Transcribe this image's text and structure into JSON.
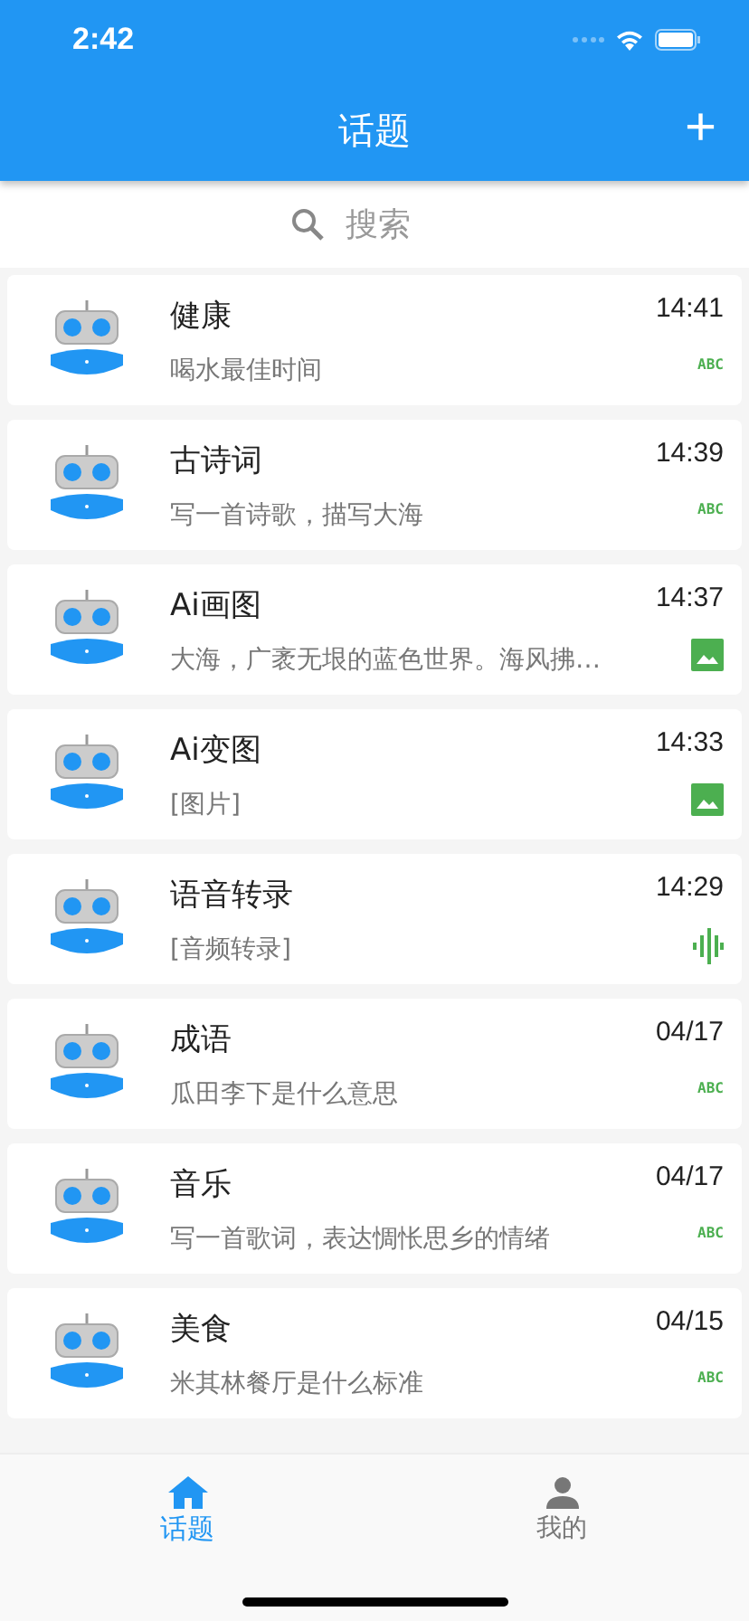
{
  "status_bar": {
    "time": "2:42"
  },
  "app_bar": {
    "title": "话题",
    "action": "+"
  },
  "search": {
    "placeholder": "搜索"
  },
  "topics": [
    {
      "title": "健康",
      "preview": "喝水最佳时间",
      "time": "14:41",
      "kind": "text",
      "type_label": "ABC"
    },
    {
      "title": "古诗词",
      "preview": "写一首诗歌，描写大海",
      "time": "14:39",
      "kind": "text",
      "type_label": "ABC"
    },
    {
      "title": "Ai画图",
      "preview": "大海，广袤无垠的蓝色世界。海风拂…",
      "time": "14:37",
      "kind": "image"
    },
    {
      "title": "Ai变图",
      "preview": "[图片]",
      "time": "14:33",
      "kind": "image"
    },
    {
      "title": "语音转录",
      "preview": "[音频转录]",
      "time": "14:29",
      "kind": "audio"
    },
    {
      "title": "成语",
      "preview": "瓜田李下是什么意思",
      "time": "04/17",
      "kind": "text",
      "type_label": "ABC"
    },
    {
      "title": "音乐",
      "preview": "写一首歌词，表达惆怅思乡的情绪",
      "time": "04/17",
      "kind": "text",
      "type_label": "ABC"
    },
    {
      "title": "美食",
      "preview": "米其林餐厅是什么标准",
      "time": "04/15",
      "kind": "text",
      "type_label": "ABC"
    }
  ],
  "tab_bar": [
    {
      "label": "话题",
      "kind": "home",
      "selected": true
    },
    {
      "label": "我的",
      "kind": "person",
      "selected": false
    }
  ]
}
